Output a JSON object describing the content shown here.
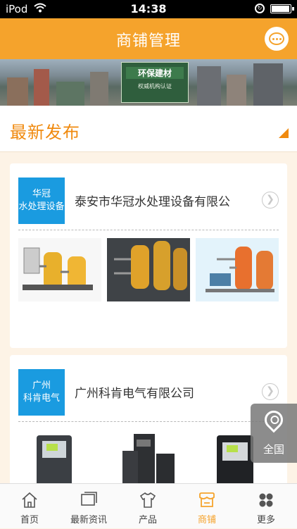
{
  "status": {
    "carrier": "iPod",
    "time": "14:38"
  },
  "header": {
    "title": "商铺管理"
  },
  "banner": {
    "headline": "环保建材",
    "caption": "权威机构认证"
  },
  "section": {
    "title": "最新发布"
  },
  "shops": [
    {
      "logo_line1": "华冠",
      "logo_line2": "水处理设备",
      "name": "泰安市华冠水处理设备有限公"
    },
    {
      "logo_line1": "广州",
      "logo_line2": "科肯电气",
      "name": "广州科肯电气有限公司"
    }
  ],
  "location": {
    "label": "全国"
  },
  "tabs": [
    {
      "label": "首页",
      "icon": "home-icon"
    },
    {
      "label": "最新资讯",
      "icon": "news-icon"
    },
    {
      "label": "产品",
      "icon": "shirt-icon"
    },
    {
      "label": "商铺",
      "icon": "store-icon"
    },
    {
      "label": "更多",
      "icon": "grid-icon"
    }
  ],
  "colors": {
    "accent": "#f5a32c",
    "section_title": "#f08a0f",
    "logo_bg": "#1a9be0"
  }
}
